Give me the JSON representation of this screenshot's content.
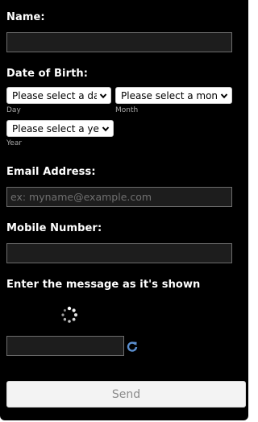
{
  "form": {
    "name_label": "Name:",
    "dob_label": "Date of Birth:",
    "day_select": "Please select a day",
    "day_sub": "Day",
    "month_select": "Please select a month",
    "month_sub": "Month",
    "year_select": "Please select a year",
    "year_sub": "Year",
    "email_label": "Email Address:",
    "email_placeholder": "ex: myname@example.com",
    "mobile_label": "Mobile Number:",
    "captcha_label": "Enter the message as it's shown",
    "send_label": "Send"
  },
  "icons": {
    "spinner": "loading-spinner-icon",
    "refresh": "refresh-icon",
    "dropdown": "chevron-down-icon"
  },
  "colors": {
    "background": "#000000",
    "field_bg": "#1d1d1d",
    "field_border": "#6c6c6c",
    "refresh": "#5b8fd0",
    "send_bg": "#f3f3f3"
  }
}
